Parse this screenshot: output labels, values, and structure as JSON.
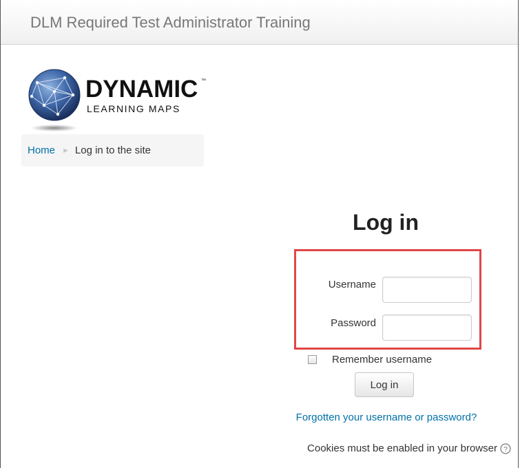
{
  "header": {
    "site_title": "DLM Required Test Administrator Training"
  },
  "logo": {
    "line1": "DYNAMIC",
    "trademark": "™",
    "line2": "LEARNING MAPS"
  },
  "breadcrumb": {
    "home": "Home",
    "separator": "►",
    "current": "Log in to the site"
  },
  "login": {
    "title": "Log in",
    "username_label": "Username",
    "password_label": "Password",
    "username_value": "",
    "password_value": "",
    "remember_label": "Remember username",
    "remember_checked": false,
    "submit_label": "Log in",
    "forgot_link": "Forgotten your username or password?",
    "cookies_notice": "Cookies must be enabled in your browser"
  },
  "colors": {
    "link": "#0070a8",
    "highlight_border": "#e04646",
    "breadcrumb_bg": "#f5f5f5"
  },
  "icons": {
    "help": "question-circle-icon"
  }
}
